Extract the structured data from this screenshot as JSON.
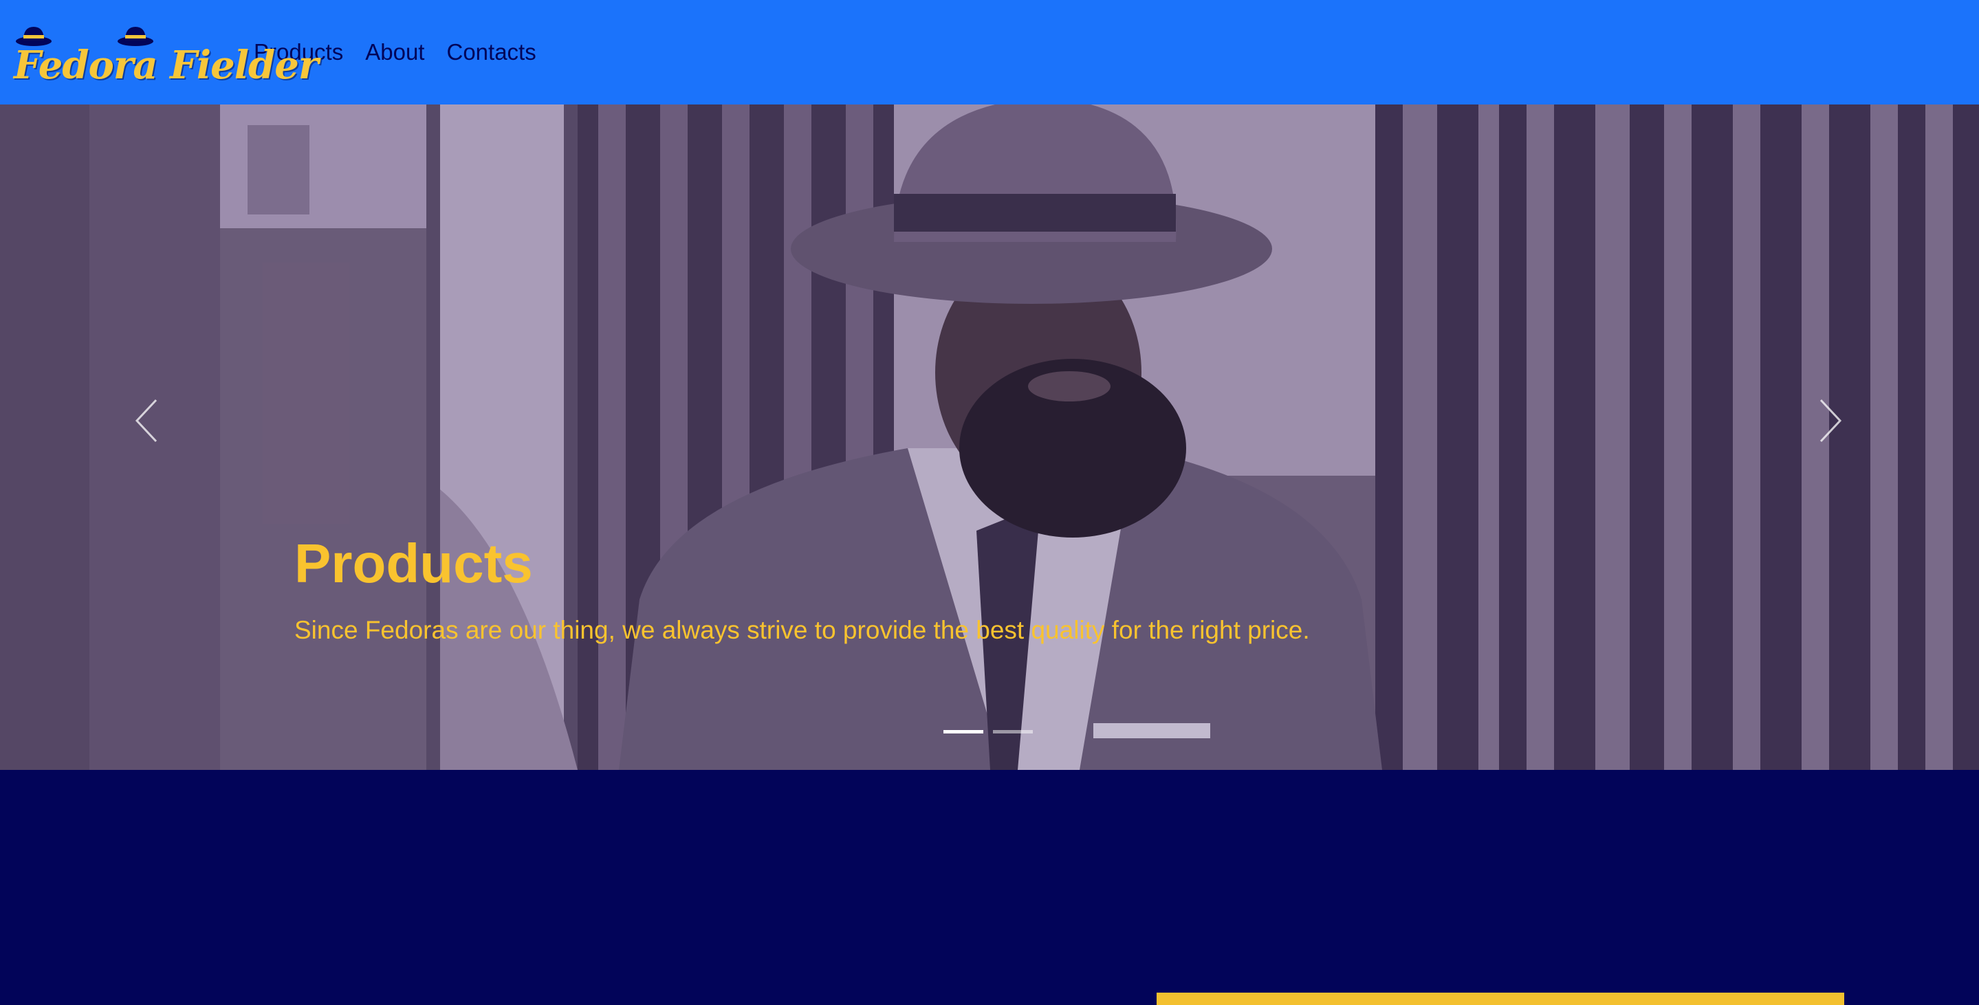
{
  "brand": {
    "name": "Fedora Fielder",
    "icon": "fedora-hat-icon"
  },
  "nav": {
    "items": [
      {
        "label": "Products"
      },
      {
        "label": "About"
      },
      {
        "label": "Contacts"
      }
    ]
  },
  "carousel": {
    "slide_title": "Products",
    "slide_text": "Since Fedoras are our thing, we always strive to provide the best quality for the right price.",
    "prev_icon": "chevron-left-icon",
    "next_icon": "chevron-right-icon",
    "slide_count": 2,
    "active_slide": 1
  },
  "colors": {
    "navbar": "#1b73fb",
    "brand_text": "#f7c63a",
    "nav_text": "#020459",
    "caption": "#f9c32f",
    "page_background": "#020459",
    "accent_block": "#f3c02f"
  }
}
